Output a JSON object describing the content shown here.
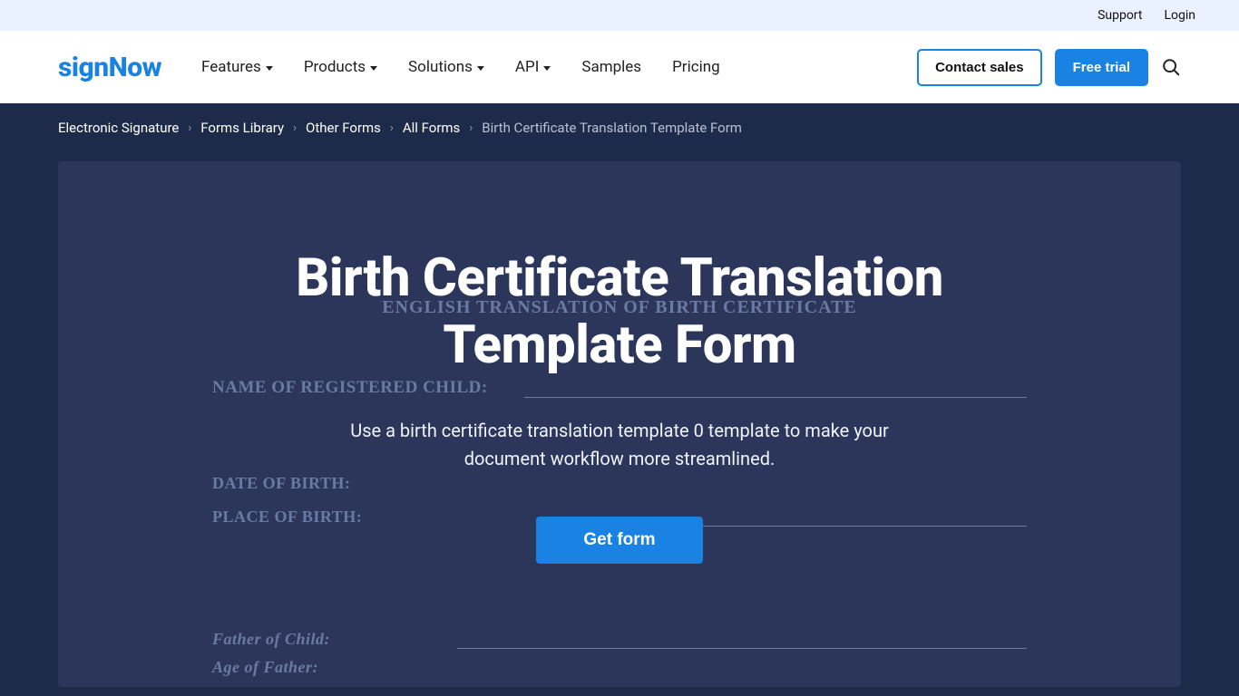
{
  "utilbar": {
    "support": "Support",
    "login": "Login"
  },
  "logo": {
    "sign": "sign",
    "now": "Now"
  },
  "nav": {
    "features": "Features",
    "products": "Products",
    "solutions": "Solutions",
    "api": "API",
    "samples": "Samples",
    "pricing": "Pricing"
  },
  "header_actions": {
    "contact_sales": "Contact sales",
    "free_trial": "Free trial"
  },
  "breadcrumb": {
    "electronic_signature": "Electronic Signature",
    "forms_library": "Forms Library",
    "other_forms": "Other Forms",
    "all_forms": "All Forms",
    "current": "Birth Certificate Translation Template Form"
  },
  "hero": {
    "title": "Birth Certificate Translation Template Form",
    "subtitle": "Use a birth certificate translation template 0 template to make your document workflow more streamlined.",
    "button": "Get form"
  },
  "doc_bg": {
    "title": "ENGLISH TRANSLATION OF BIRTH CERTIFICATE",
    "name_label": "NAME OF REGISTERED CHILD:",
    "dob_label": "DATE OF BIRTH:",
    "pob_label": "PLACE OF BIRTH:",
    "father_label": "Father of Child:",
    "age_father_label": "Age of Father:"
  }
}
